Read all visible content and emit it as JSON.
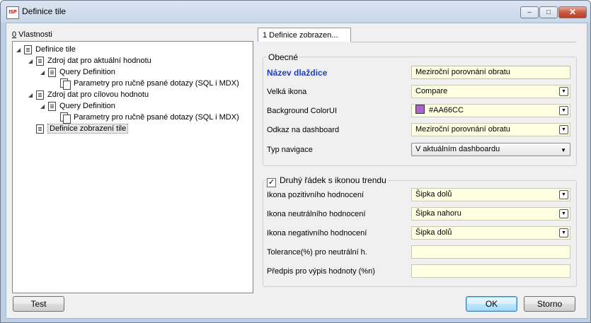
{
  "window": {
    "title": "Definice tile",
    "icon_text": "ISP",
    "controls": {
      "minimize": "–",
      "maximize": "□",
      "close": "✕"
    }
  },
  "properties": {
    "hotkey": "0",
    "label": " Vlastnosti",
    "tree": [
      {
        "label": "Definice tile",
        "level": 0
      },
      {
        "label": "Zdroj dat pro aktuální hodnotu",
        "level": 1
      },
      {
        "label": "Query Definition",
        "level": 2
      },
      {
        "label": "Parametry pro ručně psané dotazy (SQL i MDX)",
        "level": 3
      },
      {
        "label": "Zdroj dat pro cílovou hodnotu",
        "level": 1
      },
      {
        "label": "Query Definition",
        "level": 2
      },
      {
        "label": "Parametry pro ručně psané dotazy (SQL i MDX)",
        "level": 3
      },
      {
        "label": "Definice zobrazení tile",
        "level": 1,
        "selected": true
      }
    ]
  },
  "tab": {
    "label": "1 Definice zobrazen..."
  },
  "general": {
    "legend": "Obecné",
    "name_label": "Název dlaždice",
    "name_value": "Meziroční porovnání obratu",
    "big_icon_label": "Velká ikona",
    "big_icon_value": "Compare",
    "bg_color_label": "Background ColorUI",
    "bg_color_value": "#AA66CC",
    "bg_color_swatch": "#AA66CC",
    "dashboard_link_label": "Odkaz na dashboard",
    "dashboard_link_value": "Meziroční porovnání obratu",
    "nav_type_label": "Typ navigace",
    "nav_type_value": "V aktuálním dashboardu"
  },
  "trend": {
    "checkbox_label": "Druhý řádek s ikonou trendu",
    "checked": true,
    "check_mark": "✓",
    "positive_label": "Ikona pozitivního hodnocení",
    "positive_value": "Šipka dolů",
    "neutral_label": "Ikona neutrálního hodnocení",
    "neutral_value": "Šipka nahoru",
    "negative_label": "Ikona negativního hodnocení",
    "negative_value": "Šipka dolů",
    "tolerance_label": "Tolerance(%) pro neutrální h.",
    "tolerance_value": "",
    "format_label": "Předpis pro výpis hodnoty (%n)",
    "format_value": ""
  },
  "buttons": {
    "test": "Test",
    "ok": "OK",
    "cancel": "Storno"
  }
}
